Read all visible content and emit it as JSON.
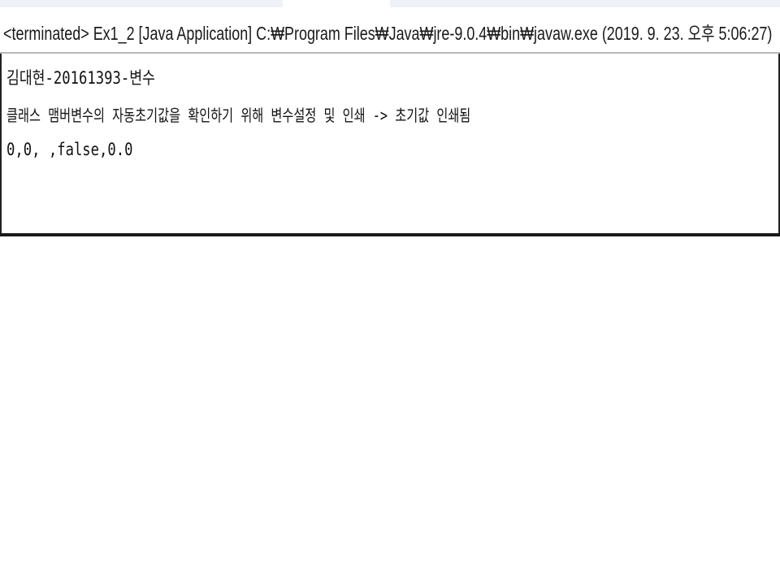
{
  "console": {
    "header": "<terminated> Ex1_2 [Java Application] C:₩Program Files₩Java₩jre-9.0.4₩bin₩javaw.exe (2019. 9. 23. 오후 5:06:27)",
    "output_lines": [
      "김대현-20161393-변수",
      "클래스 맴버변수의 자동초기값을 확인하기 위해 변수설정 및 인쇄 -> 초기값 인쇄됨",
      "0,0, ,false,0.0"
    ]
  }
}
